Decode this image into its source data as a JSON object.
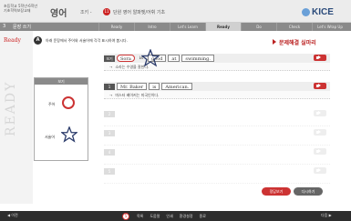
{
  "header": {
    "org_line1": "초등학교 5학년·6학년",
    "org_line2": "기초학력보장교재",
    "subject": "영어",
    "chapter_prefix": "조키 -",
    "chapter_number": "11",
    "chapter_suffix": "단원",
    "chapter_name": "영어 알파벳/어휘 기초",
    "brand": "KICE"
  },
  "navbar": {
    "unit_number": "3",
    "unit_name": "문장 쓰기",
    "steps": [
      "Ready",
      "Intro",
      "Let's Learn",
      "Ready",
      "Do",
      "Check",
      "Let's Wrap Up"
    ],
    "active_index": 3
  },
  "side": {
    "ready_tag": "Ready",
    "watermark": "READY"
  },
  "instruction": {
    "mark": "A",
    "text": "아래 문장에서 주어와 서술어에 각각 표시하여 봅시다.",
    "hint_label": "문제해결 실마리"
  },
  "example_box": {
    "title": "보기",
    "label1": "주어",
    "label2": "서술어"
  },
  "example_row": {
    "tag": "보기",
    "words": [
      "Sora",
      "is",
      "good",
      "at",
      "swimming."
    ],
    "translation": "소라는 수영을 잘한다."
  },
  "questions": [
    {
      "num": "1",
      "words": [
        "Mr. Baker",
        "is",
        "American."
      ],
      "translation": "미스터 베이커는 미국인이다."
    },
    {
      "num": "2",
      "words": [
        "",
        "",
        "",
        ""
      ],
      "translation": ""
    },
    {
      "num": "3",
      "words": [
        "",
        "",
        "",
        ""
      ],
      "translation": ""
    },
    {
      "num": "4",
      "words": [
        "",
        "",
        "",
        ""
      ],
      "translation": ""
    },
    {
      "num": "5",
      "words": [
        "",
        "",
        "",
        ""
      ],
      "translation": ""
    }
  ],
  "buttons": {
    "answer": "정답보기",
    "retry": "다시하기"
  },
  "bottom": {
    "prev": "이전",
    "page_num": "5",
    "tabs": [
      "목록",
      "도움말",
      "인쇄",
      "환경설정",
      "종료"
    ],
    "next": "다음"
  },
  "colors": {
    "accent": "#cc3333",
    "bar": "#8a8a8a",
    "dark": "#2d2d2d"
  }
}
